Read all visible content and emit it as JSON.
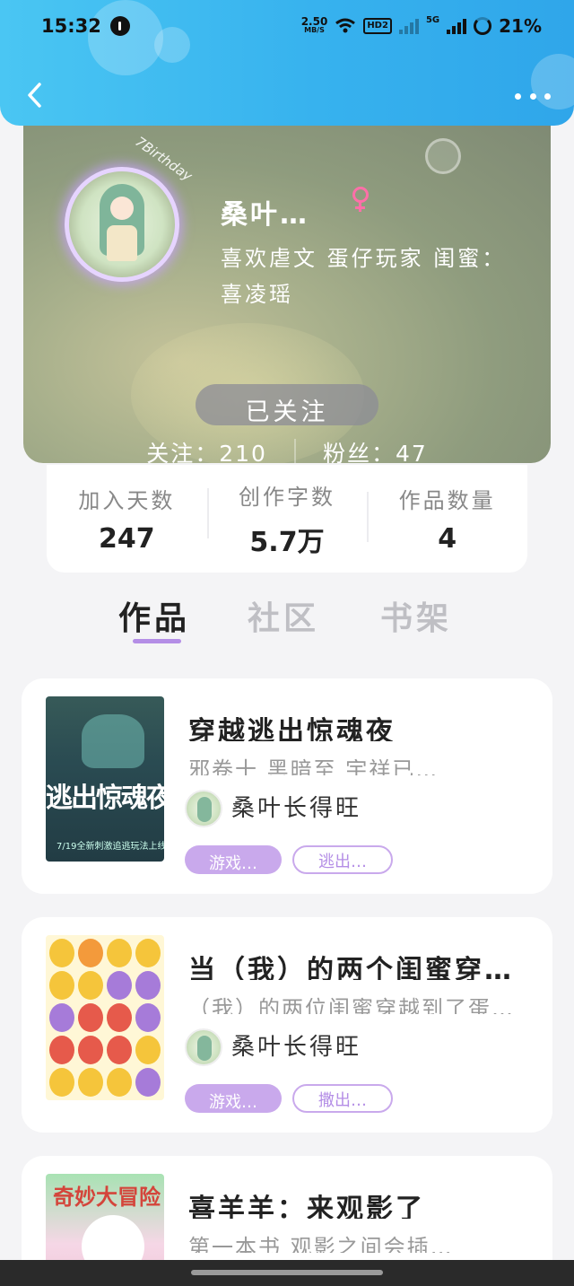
{
  "status_bar": {
    "time": "15:32",
    "net_speed": "2.50",
    "net_unit": "MB/S",
    "hd_label": "HD2",
    "net_type": "5G",
    "battery": "21%"
  },
  "profile": {
    "name": "桑叶…",
    "bio": "喜欢虐文 蛋仔玩家 闺蜜：喜凌瑶",
    "avatar_script": "7Birthday",
    "follow_button": "已关注",
    "following_text": "关注：210",
    "fans_text": "粉丝：47",
    "gender_color": "#ff6fa8"
  },
  "stats": [
    {
      "label": "加入天数",
      "value": "247"
    },
    {
      "label": "创作字数",
      "value": "5.7万"
    },
    {
      "label": "作品数量",
      "value": "4"
    }
  ],
  "tabs": [
    {
      "label": "作品",
      "active": true
    },
    {
      "label": "社区",
      "active": false
    },
    {
      "label": "书架",
      "active": false
    }
  ],
  "works": [
    {
      "title": "穿越逃出惊魂夜",
      "desc": "邪卷十 黑暗至 宇祥已…",
      "author": "桑叶长得旺",
      "tags": [
        "游戏…",
        "逃出…"
      ],
      "cover_title": "逃出惊魂夜",
      "cover_sub": "7/19全新刺激追逃玩法上线"
    },
    {
      "title": "当（我）的两个闺蜜穿…",
      "desc": "（我）的两位闺蜜穿越到了蛋…",
      "author": "桑叶长得旺",
      "tags": [
        "游戏…",
        "撒出…"
      ]
    },
    {
      "title": "喜羊羊：来观影了",
      "desc": "第一本书 观影之间会插…",
      "author": "",
      "tags": [],
      "cover_title": "奇妙大冒险"
    }
  ],
  "colors": {
    "header_gradient_start": "#4ac6f3",
    "header_gradient_end": "#2fa6ea",
    "accent_purple": "#b48ee6",
    "tag_fill": "#c9a9ec"
  }
}
